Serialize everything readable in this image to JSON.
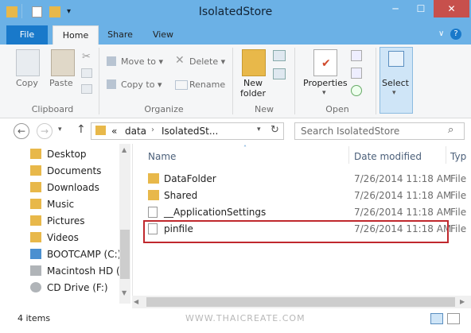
{
  "window": {
    "title": "IsolatedStore"
  },
  "ribbon_tabs": {
    "file": "File",
    "home": "Home",
    "share": "Share",
    "view": "View"
  },
  "ribbon": {
    "clipboard": {
      "copy": "Copy",
      "paste": "Paste",
      "label": "Clipboard"
    },
    "organize": {
      "move_to": "Move to",
      "copy_to": "Copy to",
      "delete": "Delete",
      "rename": "Rename",
      "label": "Organize"
    },
    "new": {
      "new_folder_line1": "New",
      "new_folder_line2": "folder",
      "label": "New"
    },
    "open": {
      "properties": "Properties",
      "label": "Open"
    },
    "select": {
      "select": "Select"
    }
  },
  "address": {
    "prefix": "«",
    "crumbs": [
      "data",
      "IsolatedSt..."
    ],
    "search_placeholder": "Search IsolatedStore"
  },
  "nav": {
    "items": [
      {
        "label": "Desktop"
      },
      {
        "label": "Documents"
      },
      {
        "label": "Downloads"
      },
      {
        "label": "Music"
      },
      {
        "label": "Pictures"
      },
      {
        "label": "Videos"
      },
      {
        "label": "BOOTCAMP (C:)"
      },
      {
        "label": "Macintosh HD (E"
      },
      {
        "label": "CD Drive (F:)"
      }
    ]
  },
  "columns": {
    "name": "Name",
    "date": "Date modified",
    "type": "Typ"
  },
  "files": [
    {
      "name": "DataFolder",
      "date": "7/26/2014 11:18 AM",
      "type": "File"
    },
    {
      "name": "Shared",
      "date": "7/26/2014 11:18 AM",
      "type": "File"
    },
    {
      "name": "__ApplicationSettings",
      "date": "7/26/2014 11:18 AM",
      "type": "File"
    },
    {
      "name": "pinfile",
      "date": "7/26/2014 11:18 AM",
      "type": "File"
    }
  ],
  "status": {
    "count": "4 items"
  },
  "watermark": "WWW.THAICREATE.COM",
  "colors": {
    "titlebar": "#6bb1e6",
    "file_tab": "#1979ca",
    "highlight": "#c0282d",
    "folder": "#e8b84a"
  }
}
